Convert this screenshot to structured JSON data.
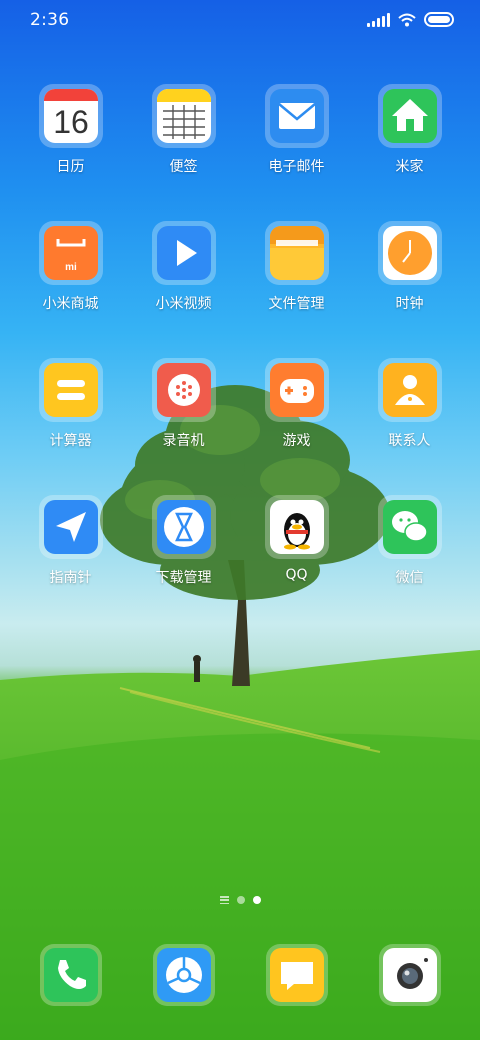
{
  "status_bar": {
    "time": "2:36"
  },
  "apps": [
    {
      "label": "日历",
      "icon": "calendar-icon",
      "day": "16"
    },
    {
      "label": "便签",
      "icon": "notes-icon"
    },
    {
      "label": "电子邮件",
      "icon": "email-icon"
    },
    {
      "label": "米家",
      "icon": "home-icon"
    },
    {
      "label": "小米商城",
      "icon": "mi-store-icon"
    },
    {
      "label": "小米视频",
      "icon": "video-play-icon"
    },
    {
      "label": "文件管理",
      "icon": "folder-icon"
    },
    {
      "label": "时钟",
      "icon": "clock-icon"
    },
    {
      "label": "计算器",
      "icon": "calculator-icon"
    },
    {
      "label": "录音机",
      "icon": "recorder-icon"
    },
    {
      "label": "游戏",
      "icon": "gamepad-icon"
    },
    {
      "label": "联系人",
      "icon": "contacts-icon"
    },
    {
      "label": "指南针",
      "icon": "compass-icon"
    },
    {
      "label": "下载管理",
      "icon": "hourglass-download-icon"
    },
    {
      "label": "QQ",
      "icon": "qq-penguin-icon"
    },
    {
      "label": "微信",
      "icon": "wechat-icon"
    }
  ],
  "pager": {
    "pages": 2,
    "active": 2
  },
  "dock": [
    {
      "icon": "phone-icon"
    },
    {
      "icon": "browser-icon"
    },
    {
      "icon": "messages-icon"
    },
    {
      "icon": "camera-icon"
    }
  ],
  "colors": {
    "sky_top": "#1560e6",
    "grass": "#3fae1f",
    "calendar_red": "#f2423a",
    "notes_yellow": "#ffd21e",
    "email_blue": "#2d8cf0",
    "home_green": "#2ec45a"
  }
}
